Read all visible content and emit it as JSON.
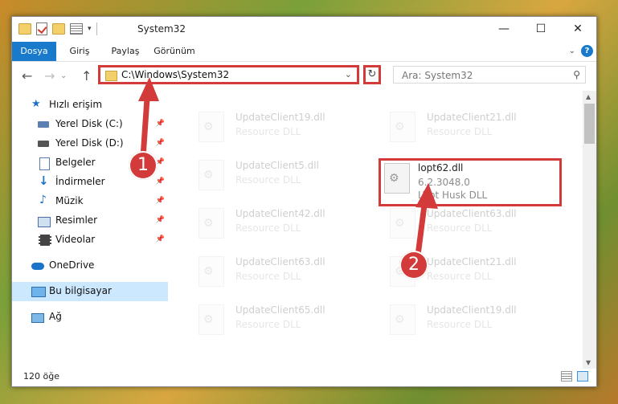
{
  "window": {
    "title": "System32",
    "controls": {
      "minimize": "—",
      "maximize": "☐",
      "close": "✕"
    }
  },
  "ribbon": {
    "tabs": [
      "Dosya",
      "Giriş",
      "Paylaş",
      "Görünüm"
    ],
    "help": "?"
  },
  "nav": {
    "address": "C:\\Windows\\System32",
    "search_placeholder": "Ara: System32",
    "back": "←",
    "forward": "→",
    "up": "↑",
    "refresh": "↻",
    "dropdown": "⌄"
  },
  "sidebar": {
    "items": [
      {
        "label": "Hızlı erişim",
        "icon": "star-icon",
        "color": "#1a73c9"
      },
      {
        "label": "Yerel Disk (C:)",
        "icon": "drive-icon",
        "color": "#4a6fa5"
      },
      {
        "label": "Yerel Disk (D:)",
        "icon": "drive-icon",
        "color": "#555555"
      },
      {
        "label": "Belgeler",
        "icon": "documents-icon",
        "color": "#5a7fb0"
      },
      {
        "label": "İndirmeler",
        "icon": "downloads-icon",
        "color": "#1a73c9"
      },
      {
        "label": "Müzik",
        "icon": "music-icon",
        "color": "#1a73c9"
      },
      {
        "label": "Resimler",
        "icon": "pictures-icon",
        "color": "#4a6fa5"
      },
      {
        "label": "Videolar",
        "icon": "videos-icon",
        "color": "#444444"
      },
      {
        "label": "OneDrive",
        "icon": "cloud-icon",
        "color": "#1a73c9"
      },
      {
        "label": "Bu bilgisayar",
        "icon": "computer-icon",
        "color": "#3a8fd6"
      },
      {
        "label": "Ağ",
        "icon": "network-icon",
        "color": "#3a8fd6"
      }
    ]
  },
  "files": [
    {
      "name": "UpdateClient19.dll",
      "desc": "Resource DLL"
    },
    {
      "name": "UpdateClient21.dll",
      "desc": "Resource DLL"
    },
    {
      "name": "UpdateClient5.dll",
      "desc": "Resource DLL"
    },
    {
      "name": "lopt62.dll",
      "version": "6.2.3048.0",
      "desc": "Lopt Husk DLL"
    },
    {
      "name": "UpdateClient42.dll",
      "desc": "Resource DLL"
    },
    {
      "name": "UpdateClient63.dll",
      "desc": "Resource DLL"
    },
    {
      "name": "UpdateClient63.dll",
      "desc": "Resource DLL"
    },
    {
      "name": "UpdateClient21.dll",
      "desc": "Resource DLL"
    },
    {
      "name": "UpdateClient65.dll",
      "desc": "Resource DLL"
    },
    {
      "name": "UpdateClient19.dll",
      "desc": "Resource DLL"
    }
  ],
  "annotations": {
    "step1": "1",
    "step2": "2",
    "color": "#d33b3b"
  },
  "status": {
    "count": "120 öğe"
  }
}
